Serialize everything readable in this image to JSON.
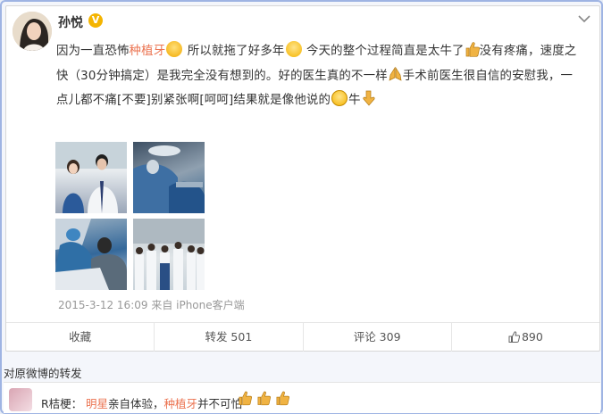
{
  "post": {
    "username": "孙悦",
    "verified_badge": "V",
    "text": {
      "line1_a": "因为一直恐怖",
      "line1_hl": "种植牙",
      "line1_b": " 所以就拖了好多年",
      "line1_c": " 今天的整个过程简直是太牛了",
      "line1_d": "没有疼痛，速度之",
      "line2_a": "快（30分钟搞定）是我完全没有想到的。好的医生真的不一样",
      "line2_b": "手术前医生很自信的安慰我，一",
      "line3_a": "点儿都不痛[不要]别紧张啊[呵呵]结果就是像他说的",
      "line3_b": "牛"
    },
    "timestamp": "2015-3-12 16:09 来自 iPhone客户端",
    "actions": {
      "collect": "收藏",
      "repost": "转发 501",
      "comment": "评论 309",
      "like": "890"
    }
  },
  "repost_header": "对原微博的转发",
  "comment": {
    "user": "R桔梗：",
    "hl1": "明星",
    "text1": "亲自体验，",
    "hl2": "种植牙",
    "text2": "并不可怕"
  },
  "colors": {
    "highlight": "#eb7350",
    "thumb": "#e9a33a"
  }
}
